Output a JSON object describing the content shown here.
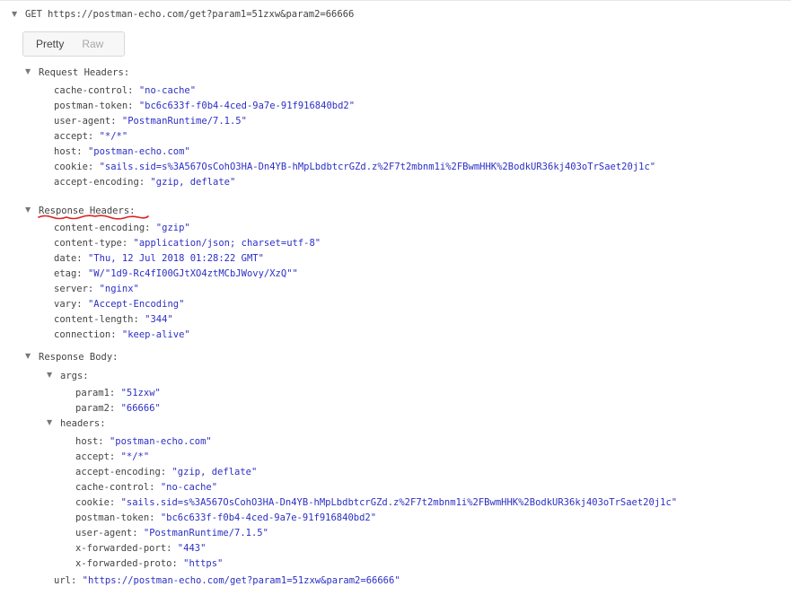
{
  "request": {
    "method": "GET",
    "url": "https://postman-echo.com/get?param1=51zxw&param2=66666"
  },
  "view_toggle": {
    "pretty_label": "Pretty",
    "raw_label": "Raw",
    "selected": "Pretty"
  },
  "sections": {
    "request_headers": {
      "label": "Request Headers:",
      "items": [
        {
          "key": "cache-control:",
          "value": "\"no-cache\""
        },
        {
          "key": "postman-token:",
          "value": "\"bc6c633f-f0b4-4ced-9a7e-91f916840bd2\""
        },
        {
          "key": "user-agent:",
          "value": "\"PostmanRuntime/7.1.5\""
        },
        {
          "key": "accept:",
          "value": "\"*/*\""
        },
        {
          "key": "host:",
          "value": "\"postman-echo.com\""
        },
        {
          "key": "cookie:",
          "value": "\"sails.sid=s%3A567OsCohO3HA-Dn4YB-hMpLbdbtcrGZd.z%2F7t2mbnm1i%2FBwmHHK%2BodkUR36kj403oTrSaet20j1c\""
        },
        {
          "key": "accept-encoding:",
          "value": "\"gzip, deflate\""
        }
      ]
    },
    "response_headers": {
      "label": "Response Headers:",
      "items": [
        {
          "key": "content-encoding:",
          "value": "\"gzip\""
        },
        {
          "key": "content-type:",
          "value": "\"application/json; charset=utf-8\""
        },
        {
          "key": "date:",
          "value": "\"Thu, 12 Jul 2018 01:28:22 GMT\""
        },
        {
          "key": "etag:",
          "value": "\"W/\"1d9-Rc4fI00GJtXO4ztMCbJWovy/XzQ\"\""
        },
        {
          "key": "server:",
          "value": "\"nginx\""
        },
        {
          "key": "vary:",
          "value": "\"Accept-Encoding\""
        },
        {
          "key": "content-length:",
          "value": "\"344\""
        },
        {
          "key": "connection:",
          "value": "\"keep-alive\""
        }
      ]
    },
    "response_body": {
      "label": "Response Body:",
      "args": {
        "label": "args:",
        "items": [
          {
            "key": "param1:",
            "value": "\"51zxw\""
          },
          {
            "key": "param2:",
            "value": "\"66666\""
          }
        ]
      },
      "headers": {
        "label": "headers:",
        "items": [
          {
            "key": "host:",
            "value": "\"postman-echo.com\""
          },
          {
            "key": "accept:",
            "value": "\"*/*\""
          },
          {
            "key": "accept-encoding:",
            "value": "\"gzip, deflate\""
          },
          {
            "key": "cache-control:",
            "value": "\"no-cache\""
          },
          {
            "key": "cookie:",
            "value": "\"sails.sid=s%3A567OsCohO3HA-Dn4YB-hMpLbdbtcrGZd.z%2F7t2mbnm1i%2FBwmHHK%2BodkUR36kj403oTrSaet20j1c\""
          },
          {
            "key": "postman-token:",
            "value": "\"bc6c633f-f0b4-4ced-9a7e-91f916840bd2\""
          },
          {
            "key": "user-agent:",
            "value": "\"PostmanRuntime/7.1.5\""
          },
          {
            "key": "x-forwarded-port:",
            "value": "\"443\""
          },
          {
            "key": "x-forwarded-proto:",
            "value": "\"https\""
          }
        ]
      },
      "url": {
        "key": "url:",
        "value": "\"https://postman-echo.com/get?param1=51zxw&param2=66666\""
      }
    }
  },
  "icons": {
    "expand": "caret-down-icon"
  },
  "colors": {
    "key_text": "#444444",
    "value_text": "#2c2fc4",
    "annotation_underline": "#e02020"
  }
}
